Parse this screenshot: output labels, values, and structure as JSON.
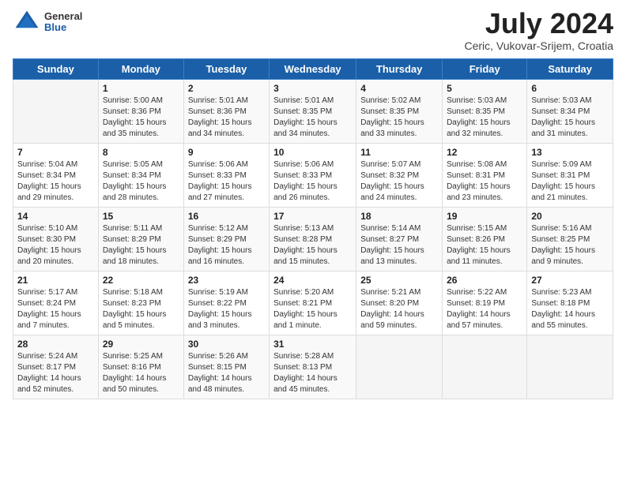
{
  "header": {
    "logo_general": "General",
    "logo_blue": "Blue",
    "title": "July 2024",
    "location": "Ceric, Vukovar-Srijem, Croatia"
  },
  "weekdays": [
    "Sunday",
    "Monday",
    "Tuesday",
    "Wednesday",
    "Thursday",
    "Friday",
    "Saturday"
  ],
  "weeks": [
    [
      {
        "day": "",
        "info": ""
      },
      {
        "day": "1",
        "info": "Sunrise: 5:00 AM\nSunset: 8:36 PM\nDaylight: 15 hours\nand 35 minutes."
      },
      {
        "day": "2",
        "info": "Sunrise: 5:01 AM\nSunset: 8:36 PM\nDaylight: 15 hours\nand 34 minutes."
      },
      {
        "day": "3",
        "info": "Sunrise: 5:01 AM\nSunset: 8:35 PM\nDaylight: 15 hours\nand 34 minutes."
      },
      {
        "day": "4",
        "info": "Sunrise: 5:02 AM\nSunset: 8:35 PM\nDaylight: 15 hours\nand 33 minutes."
      },
      {
        "day": "5",
        "info": "Sunrise: 5:03 AM\nSunset: 8:35 PM\nDaylight: 15 hours\nand 32 minutes."
      },
      {
        "day": "6",
        "info": "Sunrise: 5:03 AM\nSunset: 8:34 PM\nDaylight: 15 hours\nand 31 minutes."
      }
    ],
    [
      {
        "day": "7",
        "info": "Sunrise: 5:04 AM\nSunset: 8:34 PM\nDaylight: 15 hours\nand 29 minutes."
      },
      {
        "day": "8",
        "info": "Sunrise: 5:05 AM\nSunset: 8:34 PM\nDaylight: 15 hours\nand 28 minutes."
      },
      {
        "day": "9",
        "info": "Sunrise: 5:06 AM\nSunset: 8:33 PM\nDaylight: 15 hours\nand 27 minutes."
      },
      {
        "day": "10",
        "info": "Sunrise: 5:06 AM\nSunset: 8:33 PM\nDaylight: 15 hours\nand 26 minutes."
      },
      {
        "day": "11",
        "info": "Sunrise: 5:07 AM\nSunset: 8:32 PM\nDaylight: 15 hours\nand 24 minutes."
      },
      {
        "day": "12",
        "info": "Sunrise: 5:08 AM\nSunset: 8:31 PM\nDaylight: 15 hours\nand 23 minutes."
      },
      {
        "day": "13",
        "info": "Sunrise: 5:09 AM\nSunset: 8:31 PM\nDaylight: 15 hours\nand 21 minutes."
      }
    ],
    [
      {
        "day": "14",
        "info": "Sunrise: 5:10 AM\nSunset: 8:30 PM\nDaylight: 15 hours\nand 20 minutes."
      },
      {
        "day": "15",
        "info": "Sunrise: 5:11 AM\nSunset: 8:29 PM\nDaylight: 15 hours\nand 18 minutes."
      },
      {
        "day": "16",
        "info": "Sunrise: 5:12 AM\nSunset: 8:29 PM\nDaylight: 15 hours\nand 16 minutes."
      },
      {
        "day": "17",
        "info": "Sunrise: 5:13 AM\nSunset: 8:28 PM\nDaylight: 15 hours\nand 15 minutes."
      },
      {
        "day": "18",
        "info": "Sunrise: 5:14 AM\nSunset: 8:27 PM\nDaylight: 15 hours\nand 13 minutes."
      },
      {
        "day": "19",
        "info": "Sunrise: 5:15 AM\nSunset: 8:26 PM\nDaylight: 15 hours\nand 11 minutes."
      },
      {
        "day": "20",
        "info": "Sunrise: 5:16 AM\nSunset: 8:25 PM\nDaylight: 15 hours\nand 9 minutes."
      }
    ],
    [
      {
        "day": "21",
        "info": "Sunrise: 5:17 AM\nSunset: 8:24 PM\nDaylight: 15 hours\nand 7 minutes."
      },
      {
        "day": "22",
        "info": "Sunrise: 5:18 AM\nSunset: 8:23 PM\nDaylight: 15 hours\nand 5 minutes."
      },
      {
        "day": "23",
        "info": "Sunrise: 5:19 AM\nSunset: 8:22 PM\nDaylight: 15 hours\nand 3 minutes."
      },
      {
        "day": "24",
        "info": "Sunrise: 5:20 AM\nSunset: 8:21 PM\nDaylight: 15 hours\nand 1 minute."
      },
      {
        "day": "25",
        "info": "Sunrise: 5:21 AM\nSunset: 8:20 PM\nDaylight: 14 hours\nand 59 minutes."
      },
      {
        "day": "26",
        "info": "Sunrise: 5:22 AM\nSunset: 8:19 PM\nDaylight: 14 hours\nand 57 minutes."
      },
      {
        "day": "27",
        "info": "Sunrise: 5:23 AM\nSunset: 8:18 PM\nDaylight: 14 hours\nand 55 minutes."
      }
    ],
    [
      {
        "day": "28",
        "info": "Sunrise: 5:24 AM\nSunset: 8:17 PM\nDaylight: 14 hours\nand 52 minutes."
      },
      {
        "day": "29",
        "info": "Sunrise: 5:25 AM\nSunset: 8:16 PM\nDaylight: 14 hours\nand 50 minutes."
      },
      {
        "day": "30",
        "info": "Sunrise: 5:26 AM\nSunset: 8:15 PM\nDaylight: 14 hours\nand 48 minutes."
      },
      {
        "day": "31",
        "info": "Sunrise: 5:28 AM\nSunset: 8:13 PM\nDaylight: 14 hours\nand 45 minutes."
      },
      {
        "day": "",
        "info": ""
      },
      {
        "day": "",
        "info": ""
      },
      {
        "day": "",
        "info": ""
      }
    ]
  ]
}
